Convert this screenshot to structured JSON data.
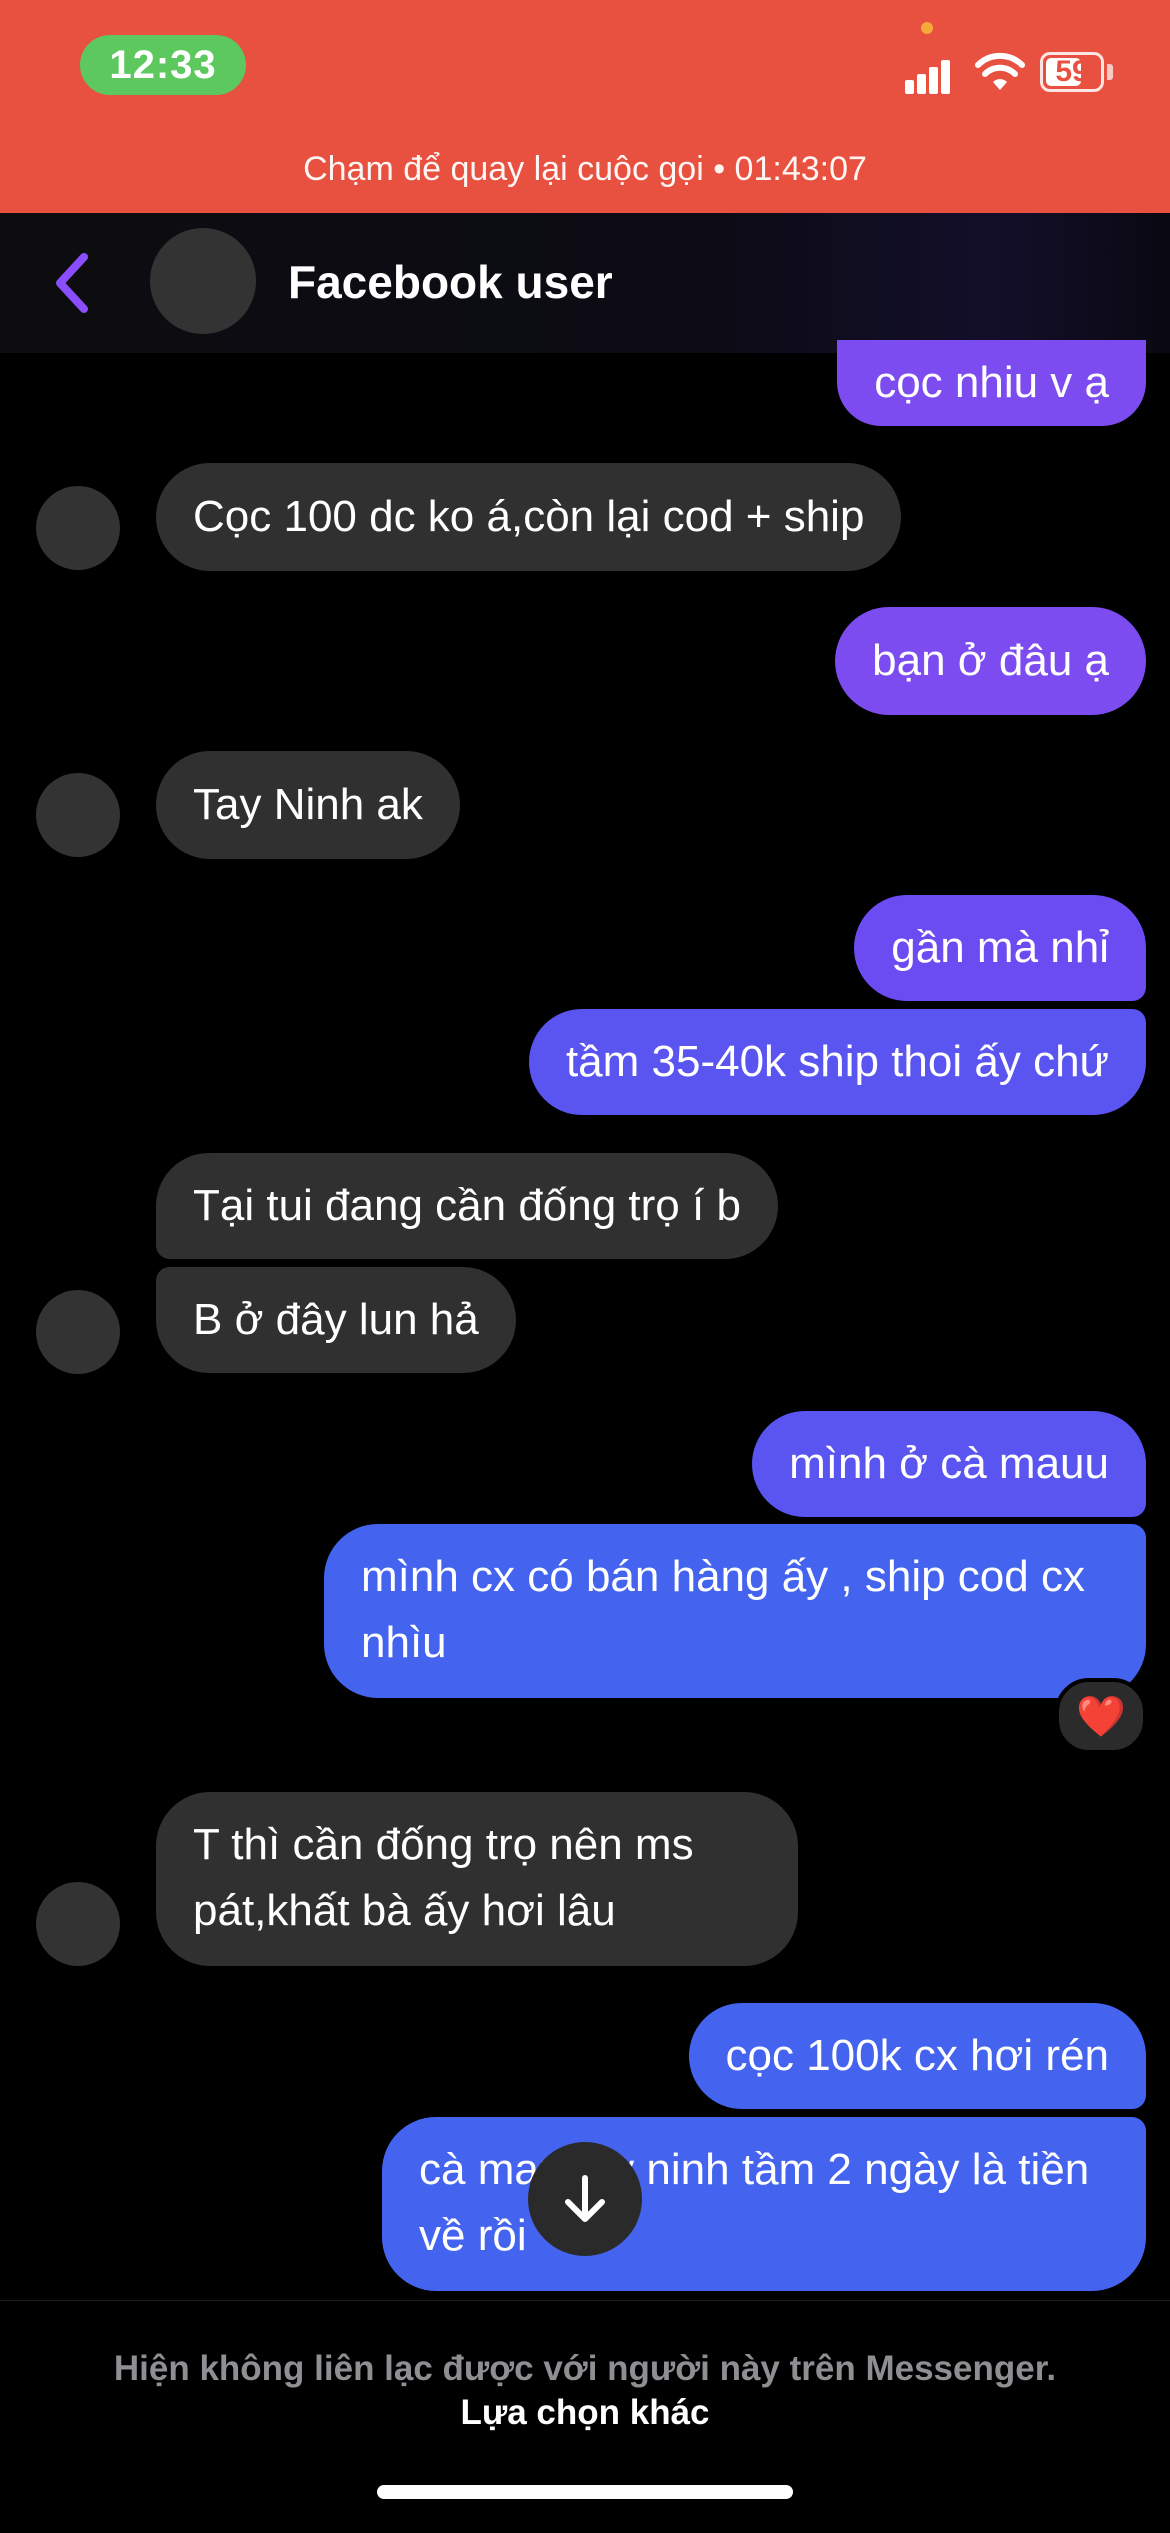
{
  "status_bar": {
    "time": "12:33",
    "battery": "59",
    "call_banner": "Chạm để quay lại cuộc gọi • 01:43:07"
  },
  "header": {
    "contact_name": "Facebook user",
    "back_icon": "chevron-left-icon"
  },
  "messages": [
    {
      "from": "me",
      "text": "cọc nhiu v ạ"
    },
    {
      "from": "them",
      "text": "Cọc 100 dc ko á,còn lại cod + ship"
    },
    {
      "from": "me",
      "text": "bạn ở đâu ạ"
    },
    {
      "from": "them",
      "text": "Tay Ninh ak"
    },
    {
      "from": "me",
      "text": "gần mà nhỉ"
    },
    {
      "from": "me",
      "text": "tầm 35-40k ship thoi ấy chứ"
    },
    {
      "from": "them",
      "text": "Tại tui đang cần đống trọ í b"
    },
    {
      "from": "them",
      "text": "B ở đây lun hả"
    },
    {
      "from": "me",
      "text": "mình ở cà mauu"
    },
    {
      "from": "me",
      "text": "mình cx có bán hàng ấy , ship cod cx nhìu",
      "reaction": "❤️"
    },
    {
      "from": "them",
      "text": "T thì cần đống trọ nên ms pát,khất bà ấy hơi lâu"
    },
    {
      "from": "me",
      "text": "cọc 100k cx hơi rén"
    },
    {
      "from": "me",
      "text": "cà mau tây ninh tầm 2 ngày là tiền về rồi"
    }
  ],
  "footer": {
    "notice": "Hiện không liên lạc được với người này trên Messenger.",
    "link": "Lựa chọn khác"
  },
  "colors": {
    "call_banner_bg": "#e8503f",
    "time_pill": "#5cc85e",
    "incoming_bubble": "#303030",
    "outgoing_bubble_gradient": [
      "#7c4cf0",
      "#4464f0"
    ],
    "accent": "#8a4dff"
  }
}
